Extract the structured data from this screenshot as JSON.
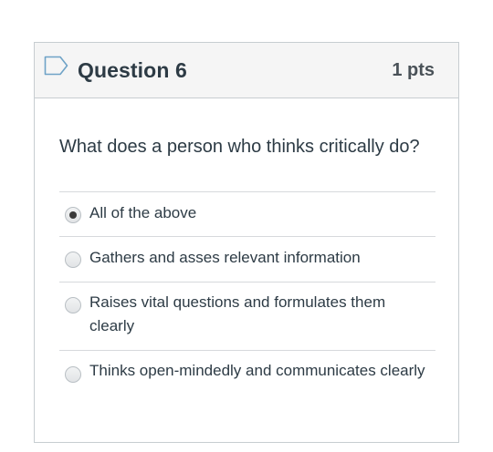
{
  "question": {
    "title": "Question 6",
    "points": "1 pts",
    "text": "What does a person who thinks critically do?",
    "flag_icon": "flag-outline-icon"
  },
  "answers": [
    {
      "label": "All of the above",
      "selected": true
    },
    {
      "label": "Gathers and asses relevant information",
      "selected": false
    },
    {
      "label": "Raises vital questions and formulates them clearly",
      "selected": false
    },
    {
      "label": "Thinks open-mindedly and communicates clearly",
      "selected": false
    }
  ],
  "colors": {
    "header_bg": "#f5f5f5",
    "border": "#c7cdd1",
    "text": "#2d3b45",
    "flag": "#6fa3c7"
  }
}
